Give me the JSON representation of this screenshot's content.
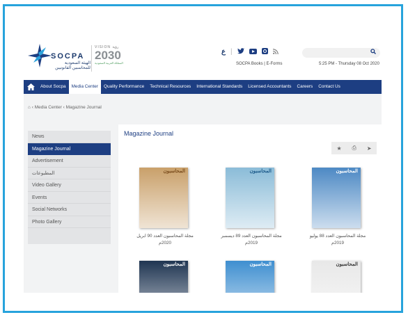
{
  "header": {
    "logo_name": "SOCPA",
    "logo_arabic": "الهيئة السعودية للمحاسبين القانونيين",
    "vision_small": "VISION رؤية",
    "vision_year": "2030",
    "vision_sub": "المملكة العربية السعودية",
    "top_links": "SOCPA Books  |  E-Forms",
    "datetime": "5:25 PM - Thursday 08 Oct 2020",
    "search_placeholder": "",
    "social_icons": [
      "arabic-icon",
      "twitter-icon",
      "youtube-icon",
      "instagram-icon",
      "rss-icon"
    ],
    "social_glyphs": [
      "ع",
      "🐦",
      "▶",
      "◙",
      "\\"
    ]
  },
  "nav": {
    "home_glyph": "⌂",
    "items": [
      "About Socpa",
      "Media Center",
      "Quality Performance",
      "Technical Resources",
      "International Standards",
      "Licensed Accountants",
      "Careers",
      "Contact Us"
    ],
    "active_index": 1
  },
  "breadcrumb": {
    "home_glyph": "⌂",
    "items": [
      "Media Center",
      "Magazine Journal"
    ]
  },
  "sidebar": {
    "items": [
      "News",
      "Magazine Journal",
      "Advertisement",
      "المطبوعات",
      "Video Gallery",
      "Events",
      "Social Networks",
      "Photo Gallery"
    ],
    "active_index": 1
  },
  "main": {
    "title": "Magazine Journal",
    "tools": [
      "★",
      "⎙",
      "➤"
    ],
    "magazines": [
      {
        "caption_line1": "مجلة المحاسبون العدد 90 ابريل",
        "caption_line2": "2020م",
        "masthead": "المحاسبون",
        "bg": "#c9a06a",
        "mast_color": "#7a4d1e"
      },
      {
        "caption_line1": "مجلة المحاسبون العدد 89 ديسمبر",
        "caption_line2": "2019م",
        "masthead": "المحاسبون",
        "bg": "#8bbcd8",
        "mast_color": "#1d5a8a"
      },
      {
        "caption_line1": "مجلة المحاسبون العدد 88 يوليو",
        "caption_line2": "2019م",
        "masthead": "المحاسبون",
        "bg": "#4d89c4",
        "mast_color": "#ffffff"
      },
      {
        "caption_line1": "",
        "caption_line2": "",
        "masthead": "المحاسبون",
        "bg": "#1f3552",
        "mast_color": "#ffffff"
      },
      {
        "caption_line1": "",
        "caption_line2": "",
        "masthead": "المحاسبون",
        "bg": "#3f8fd0",
        "mast_color": "#ffffff"
      },
      {
        "caption_line1": "",
        "caption_line2": "",
        "masthead": "المحاسبون",
        "bg": "#e8e8e8",
        "mast_color": "#333333"
      }
    ]
  },
  "colors": {
    "brand": "#1d3e82",
    "frame": "#27a3dc"
  }
}
